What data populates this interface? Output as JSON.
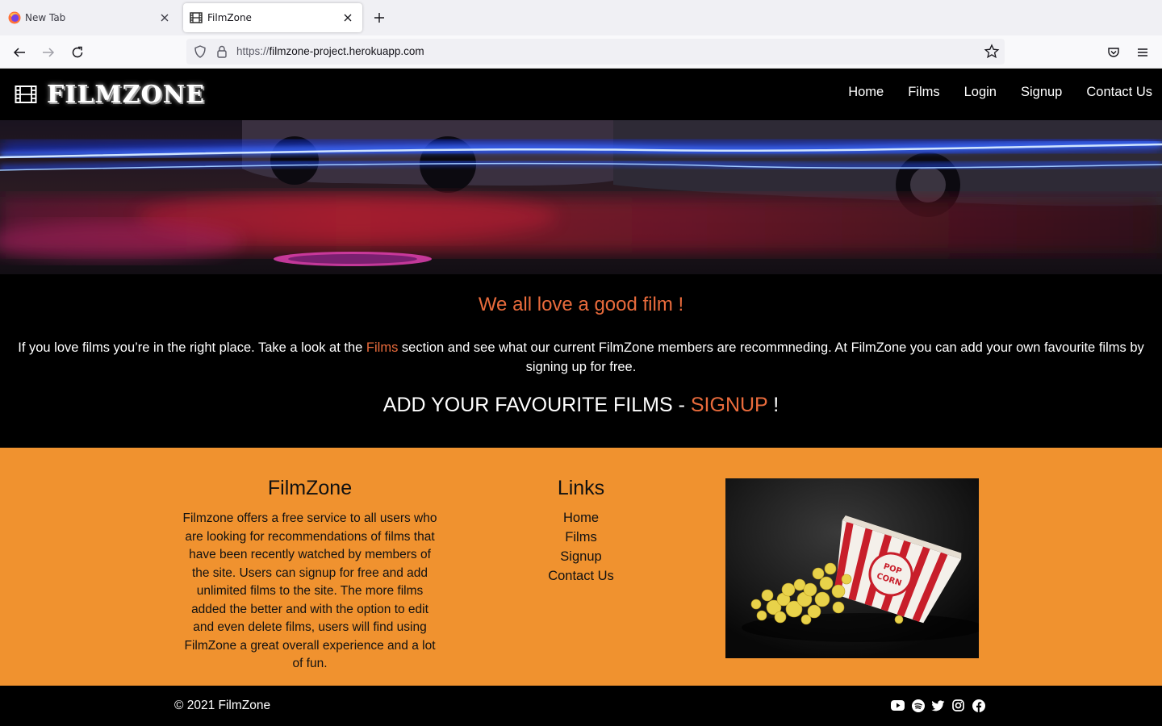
{
  "browser": {
    "tabs": [
      {
        "label": "New Tab",
        "icon": "firefox-icon"
      },
      {
        "label": "FilmZone",
        "icon": "film-icon"
      }
    ],
    "url_scheme": "https://",
    "url_host": "filmzone-project.herokuapp.com"
  },
  "site": {
    "logo": "FILMZONE",
    "nav": [
      "Home",
      "Films",
      "Login",
      "Signup",
      "Contact Us"
    ]
  },
  "intro": {
    "title": "We all love a good film !",
    "text_before": "If you love films you’re in the right place. Take a look at the ",
    "text_link": "Films",
    "text_after": " section and see what our current FilmZone members are recommneding. At FilmZone you can add your own favourite films by signing up for free.",
    "cta_before": "ADD YOUR FAVOURITE FILMS - ",
    "cta_link": "SIGNUP",
    "cta_after": " !"
  },
  "footer": {
    "about_title": "FilmZone",
    "about_text": "Filmzone offers a free service to all users who are looking for recommendations of films that have been recently watched by members of the site. Users can signup for free and add unlimited films to the site. The more films added the better and with the option to edit and even delete films, users will find using FilmZone a great overall experience and a lot of fun.",
    "links_title": "Links",
    "links": [
      "Home",
      "Films",
      "Signup",
      "Contact Us"
    ],
    "popcorn_label": "POP CORN",
    "copyright": "© 2021 FilmZone",
    "socials": [
      "youtube-icon",
      "spotify-icon",
      "twitter-icon",
      "instagram-icon",
      "facebook-icon"
    ]
  },
  "colors": {
    "accent": "#e96b3c",
    "footer_bg": "#f0922f",
    "page_bg": "#000000"
  }
}
